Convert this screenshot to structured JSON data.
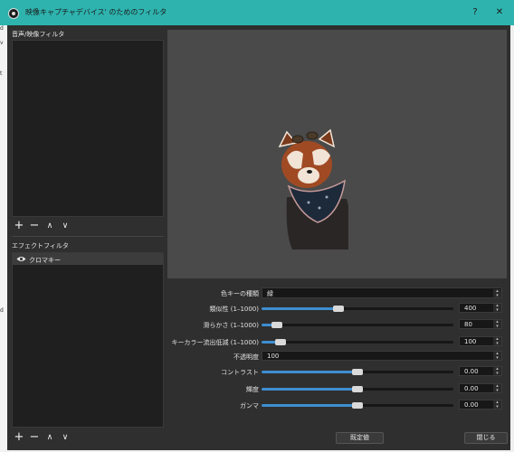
{
  "window": {
    "title": "映像キャプチャデバイス' のためのフィルタ",
    "help_label": "?",
    "close_label": "✕"
  },
  "behind": {
    "items": [
      "d",
      "v",
      "t",
      "d"
    ]
  },
  "audio_video": {
    "label": "音声/映像フィルタ",
    "toolbar": [
      "+",
      "−",
      "∧",
      "∨"
    ]
  },
  "effect": {
    "label": "エフェクトフィルタ",
    "items": [
      {
        "icon": "eye-icon",
        "label": "クロマキー"
      }
    ],
    "toolbar": [
      "+",
      "−",
      "∧",
      "∨"
    ]
  },
  "settings": {
    "key_color": {
      "label": "色キーの種類",
      "value": "緑"
    },
    "sliders": [
      {
        "label": "類似性 (1–1000)",
        "value": "400",
        "level": 0.4
      },
      {
        "label": "滑らかさ (1–1000)",
        "value": "80",
        "level": 0.08
      },
      {
        "label": "キーカラー流出低減 (1–1000)",
        "value": "100",
        "level": 0.1
      }
    ],
    "opacity": {
      "label": "不透明度",
      "value": "100"
    },
    "adjust": [
      {
        "label": "コントラスト",
        "value": "0.00",
        "level": 0.5
      },
      {
        "label": "輝度",
        "value": "0.00",
        "level": 0.5
      },
      {
        "label": "ガンマ",
        "value": "0.00",
        "level": 0.5
      }
    ]
  },
  "buttons": {
    "defaults": "既定値",
    "close": "閉じる"
  },
  "colors": {
    "titlebar": "#2eb3ae",
    "accent": "#3e8ed0",
    "background": "#2f2f2f"
  }
}
